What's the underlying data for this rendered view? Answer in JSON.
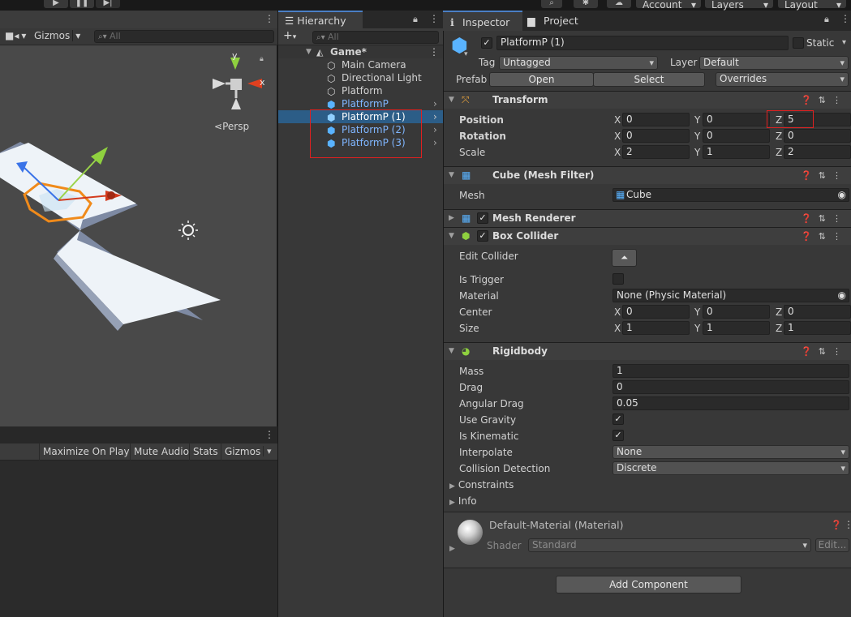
{
  "topbar": {
    "account": "Account",
    "layers": "Layers",
    "layout": "Layout"
  },
  "scene": {
    "gizmos": "Gizmos",
    "search_placeholder": "All",
    "persp": "Persp",
    "axis_y": "y",
    "axis_x": "x"
  },
  "game": {
    "buttons": [
      "Maximize On Play",
      "Mute Audio",
      "Stats",
      "Gizmos"
    ]
  },
  "hierarchy": {
    "tab": "Hierarchy",
    "search_placeholder": "All",
    "scene": "Game*",
    "items": [
      {
        "label": "Main Camera",
        "type": "camera"
      },
      {
        "label": "Directional Light",
        "type": "object"
      },
      {
        "label": "Platform",
        "type": "object"
      },
      {
        "label": "PlatformP",
        "type": "prefab"
      },
      {
        "label": "PlatformP (1)",
        "type": "prefab",
        "selected": true
      },
      {
        "label": "PlatformP (2)",
        "type": "prefab"
      },
      {
        "label": "PlatformP (3)",
        "type": "prefab"
      }
    ]
  },
  "inspector": {
    "tab_inspector": "Inspector",
    "tab_project": "Project",
    "object_name": "PlatformP (1)",
    "static": "Static",
    "tag_label": "Tag",
    "tag_value": "Untagged",
    "layer_label": "Layer",
    "layer_value": "Default",
    "prefab_label": "Prefab",
    "prefab_open": "Open",
    "prefab_select": "Select",
    "prefab_overrides": "Overrides",
    "transform": {
      "title": "Transform",
      "position_label": "Position",
      "rotation_label": "Rotation",
      "scale_label": "Scale",
      "position": [
        "0",
        "0",
        "5"
      ],
      "rotation": [
        "0",
        "0",
        "0"
      ],
      "scale": [
        "2",
        "1",
        "2"
      ]
    },
    "mesh_filter": {
      "title": "Cube (Mesh Filter)",
      "mesh_label": "Mesh",
      "mesh_value": "Cube"
    },
    "mesh_renderer": {
      "title": "Mesh Renderer"
    },
    "box_collider": {
      "title": "Box Collider",
      "edit_collider": "Edit Collider",
      "is_trigger": "Is Trigger",
      "material_label": "Material",
      "material_value": "None (Physic Material)",
      "center_label": "Center",
      "size_label": "Size",
      "center": [
        "0",
        "0",
        "0"
      ],
      "size": [
        "1",
        "1",
        "1"
      ]
    },
    "rigidbody": {
      "title": "Rigidbody",
      "mass_label": "Mass",
      "mass": "1",
      "drag_label": "Drag",
      "drag": "0",
      "angular_drag_label": "Angular Drag",
      "angular_drag": "0.05",
      "use_gravity_label": "Use Gravity",
      "is_kinematic_label": "Is Kinematic",
      "interpolate_label": "Interpolate",
      "interpolate": "None",
      "collision_label": "Collision Detection",
      "collision": "Discrete",
      "constraints": "Constraints",
      "info": "Info"
    },
    "material": {
      "title": "Default-Material (Material)",
      "shader_label": "Shader",
      "shader_value": "Standard",
      "edit": "Edit..."
    },
    "add_component": "Add Component",
    "axis_labels": [
      "X",
      "Y",
      "Z"
    ]
  },
  "colors": {
    "selection": "#2c5d87",
    "prefab_blue": "#7fb6ff",
    "highlight_red": "#e02020"
  }
}
